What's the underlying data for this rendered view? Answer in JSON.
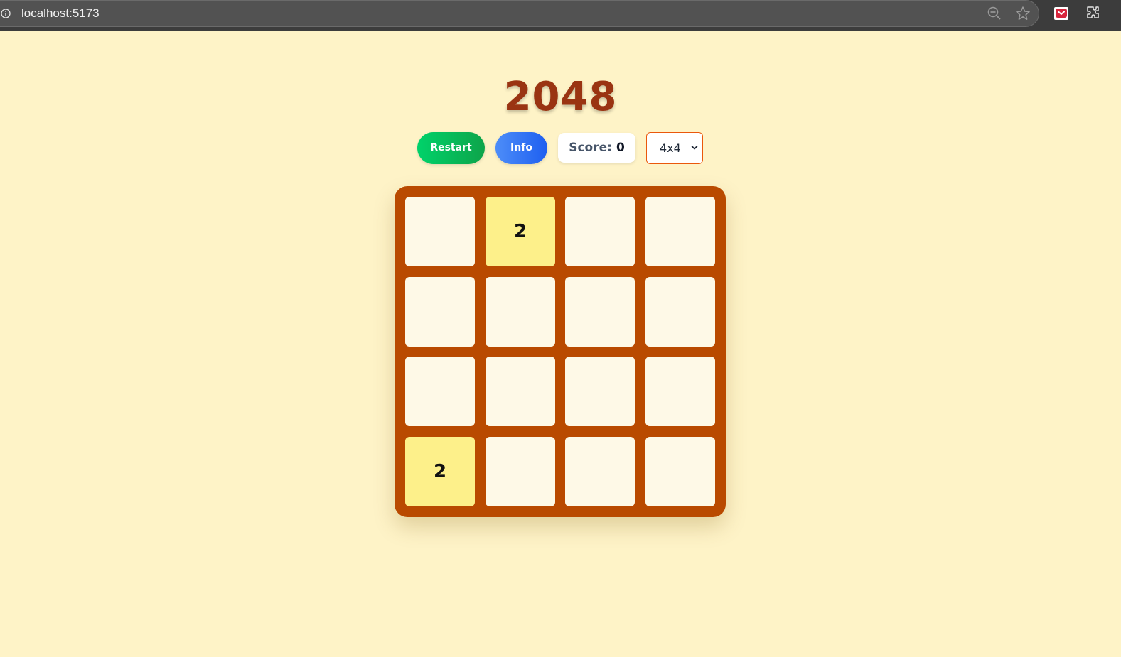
{
  "browser": {
    "url": "localhost:5173",
    "icons": [
      "info-icon",
      "zoom-out-icon",
      "star-icon",
      "pocket-icon",
      "extensions-icon"
    ]
  },
  "game": {
    "title": "2048",
    "restart_label": "Restart",
    "info_label": "Info",
    "score_label": "Score:",
    "score_value": "0",
    "grid_size_selected": "4x4",
    "colors": {
      "background": "#fef3c7",
      "title": "#9a3412",
      "board": "#b94a00",
      "empty_cell": "#fef9e7",
      "tile_2": "#fdf08a",
      "restart": "#0ea44a",
      "info": "#1e5ff0",
      "select_border": "#ea580c"
    },
    "board": [
      [
        "",
        "2",
        "",
        ""
      ],
      [
        "",
        "",
        "",
        ""
      ],
      [
        "",
        "",
        "",
        ""
      ],
      [
        "2",
        "",
        "",
        ""
      ]
    ]
  }
}
